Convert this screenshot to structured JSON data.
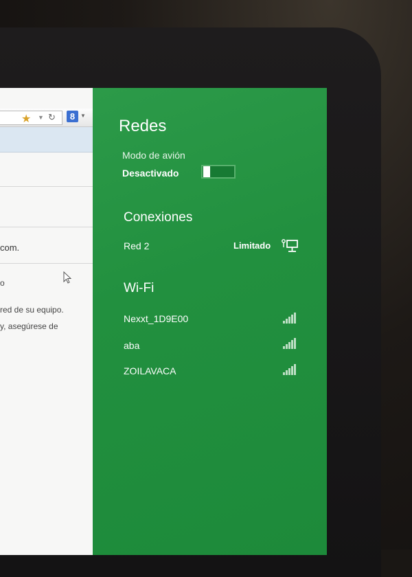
{
  "browser": {
    "page_lines": [
      "com.",
      "o",
      "red de su equipo.",
      "y, asegúrese de"
    ]
  },
  "panel": {
    "title": "Redes",
    "airplane_mode": {
      "label": "Modo de avión",
      "state": "Desactivado",
      "on": false
    },
    "connections": {
      "heading": "Conexiones",
      "items": [
        {
          "name": "Red  2",
          "status": "Limitado",
          "icon": "wired-network-icon"
        }
      ]
    },
    "wifi": {
      "heading": "Wi-Fi",
      "networks": [
        {
          "name": "Nexxt_1D9E00",
          "icon": "wifi-signal-icon"
        },
        {
          "name": "aba",
          "icon": "wifi-signal-icon"
        },
        {
          "name": "ZOILAVACA",
          "icon": "wifi-signal-icon"
        }
      ]
    }
  },
  "colors": {
    "panel": "#229340",
    "accent_star": "#d9a22a",
    "search_engine": "#3b6fd1"
  }
}
